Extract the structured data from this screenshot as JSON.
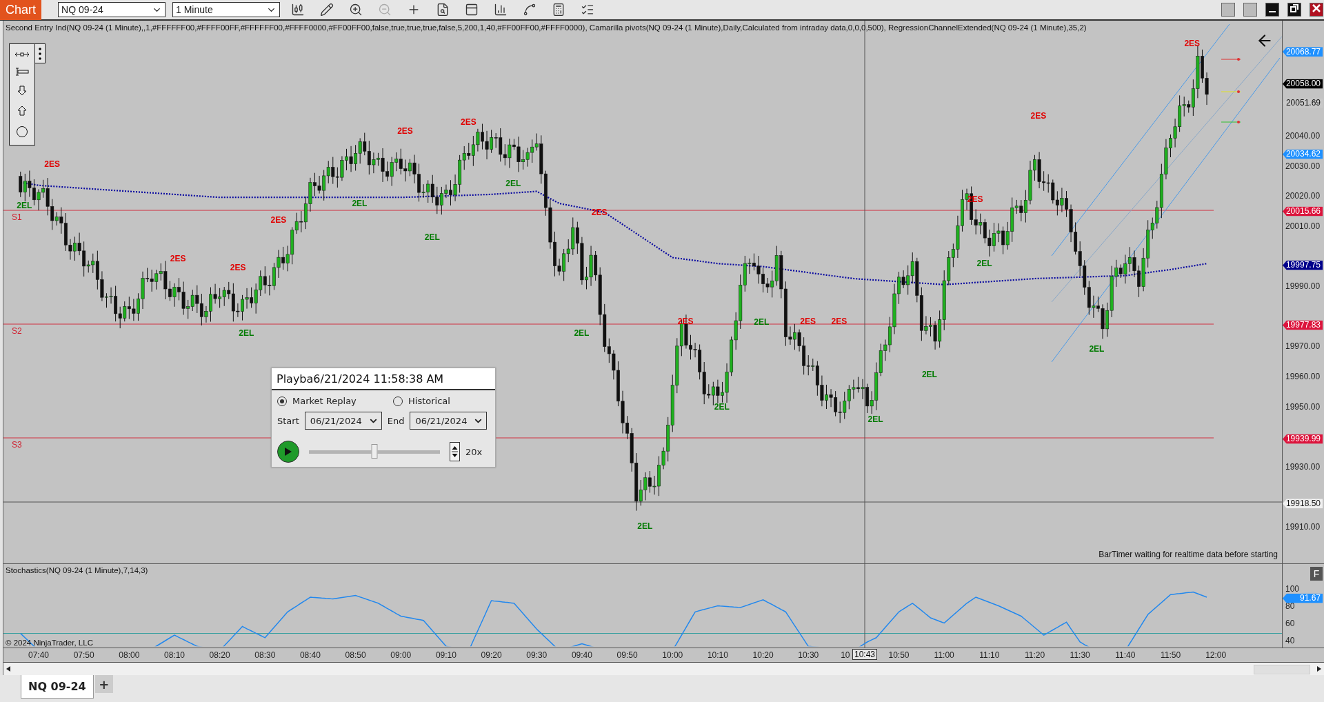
{
  "toolbar": {
    "app_tab": "Chart",
    "instrument": "NQ 09-24",
    "interval": "1 Minute"
  },
  "chart": {
    "indicator_label": "Second Entry Ind(NQ 09-24 (1 Minute),,1,#FFFFFF00,#FFFF00FF,#FFFFFF00,#FFFF0000,#FF00FF00,false,true,true,true,false,5,200,1,40,#FF00FF00,#FFFF0000), Camarilla pivots(NQ 09-24 (1 Minute),Daily,Calculated from intraday data,0,0,0,500), RegressionChannelExtended(NQ 09-24 (1 Minute),35,2)",
    "pivot_labels": [
      "S1",
      "S2",
      "S3"
    ],
    "signals": [
      {
        "kind": "short",
        "text": "2ES"
      },
      {
        "kind": "short",
        "text": "2ES"
      },
      {
        "kind": "short",
        "text": "2ES"
      },
      {
        "kind": "short",
        "text": "2ES"
      },
      {
        "kind": "short",
        "text": "2ES"
      },
      {
        "kind": "short",
        "text": "2ES"
      },
      {
        "kind": "short",
        "text": "2ES"
      },
      {
        "kind": "short",
        "text": "2ES"
      },
      {
        "kind": "short",
        "text": "2ES"
      },
      {
        "kind": "short",
        "text": "2ES"
      },
      {
        "kind": "short",
        "text": "2ES"
      },
      {
        "kind": "short",
        "text": "2ES"
      },
      {
        "kind": "short",
        "text": "2ES"
      },
      {
        "kind": "long",
        "text": "2EL"
      },
      {
        "kind": "long",
        "text": "2EL"
      },
      {
        "kind": "long",
        "text": "2EL"
      },
      {
        "kind": "long",
        "text": "2EL"
      },
      {
        "kind": "long",
        "text": "2EL"
      },
      {
        "kind": "long",
        "text": "2EL"
      },
      {
        "kind": "long",
        "text": "2EL"
      },
      {
        "kind": "long",
        "text": "2EL"
      },
      {
        "kind": "long",
        "text": "2EL"
      },
      {
        "kind": "long",
        "text": "2EL"
      },
      {
        "kind": "long",
        "text": "2EL"
      },
      {
        "kind": "long",
        "text": "2EL"
      },
      {
        "kind": "long",
        "text": "2EL"
      }
    ],
    "status_text": "BarTimer waiting for realtime data before starting",
    "price_ticks": [
      "20040.00",
      "20030.00",
      "20020.00",
      "20010.00",
      "19990.00",
      "19970.00",
      "19960.00",
      "19950.00",
      "19930.00",
      "19910.00"
    ],
    "price_markers": [
      {
        "label": "20068.77",
        "color": "#1e90ff"
      },
      {
        "label": "20058.00",
        "color": "#000000"
      },
      {
        "label": "20051.69",
        "color": "#c8c8c8"
      },
      {
        "label": "20034.62",
        "color": "#1e90ff"
      },
      {
        "label": "20015.66",
        "color": "#dc143c"
      },
      {
        "label": "19997.75",
        "color": "#00008b"
      },
      {
        "label": "19977.83",
        "color": "#dc143c"
      },
      {
        "label": "19939.99",
        "color": "#dc143c"
      },
      {
        "label": "19918.50",
        "color": "#f0f0f0"
      }
    ]
  },
  "playback": {
    "title": "Playba",
    "timestamp": "6/21/2024 11:58:38 AM",
    "modes": [
      {
        "label": "Market Replay",
        "selected": true
      },
      {
        "label": "Historical",
        "selected": false
      }
    ],
    "start_label": "Start",
    "start_date": "06/21/2024",
    "end_label": "End",
    "end_date": "06/21/2024",
    "speed_slider": {
      "level": 0.5
    },
    "speed": "20x"
  },
  "stochastics": {
    "label": "Stochastics(NQ 09-24 (1 Minute),7,14,3)",
    "copyright": "© 2024 NinjaTrader, LLC",
    "ticks": [
      "100",
      "80",
      "60",
      "40"
    ],
    "marker": {
      "label": "91.67",
      "color": "#1e90ff"
    },
    "button": "F"
  },
  "time_axis": {
    "labels": [
      "07:40",
      "07:50",
      "08:00",
      "08:10",
      "08:20",
      "08:30",
      "08:40",
      "08:50",
      "09:00",
      "09:10",
      "09:20",
      "09:30",
      "09:40",
      "09:50",
      "10:00",
      "10:10",
      "10:20",
      "10:30",
      "10",
      "10:50",
      "11:00",
      "11:10",
      "11:20",
      "11:30",
      "11:40",
      "11:50",
      "12:00"
    ],
    "cursor_label": "10:43"
  },
  "tabs": [
    {
      "label": "NQ 09-24",
      "selected": true
    }
  ],
  "add_tab": "+"
}
